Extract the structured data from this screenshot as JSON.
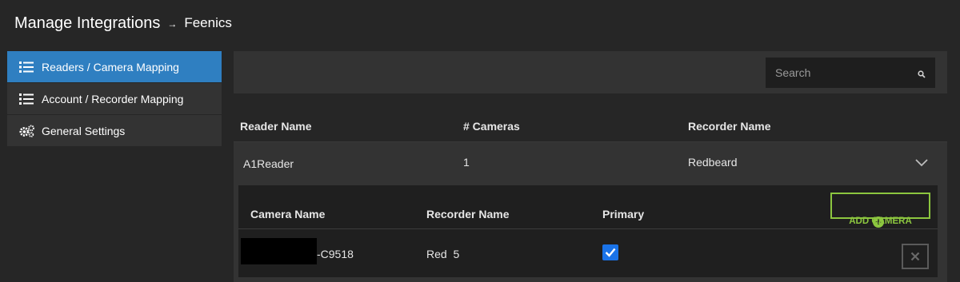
{
  "header": {
    "title": "Manage Integrations",
    "separator": "→",
    "crumb": "Feenics"
  },
  "sidebar": {
    "items": [
      {
        "label": "Readers / Camera Mapping",
        "icon": "list-icon",
        "active": true
      },
      {
        "label": "Account / Recorder Mapping",
        "icon": "list-icon",
        "active": false
      },
      {
        "label": "General Settings",
        "icon": "gears-icon",
        "active": false
      }
    ]
  },
  "search": {
    "placeholder": "Search",
    "value": ""
  },
  "table": {
    "columns": [
      "Reader Name",
      "# Cameras",
      "Recorder Name"
    ],
    "rows": [
      {
        "reader": "A1Reader",
        "cameras": "1",
        "recorder": "Redbeard"
      }
    ]
  },
  "subtable": {
    "columns": [
      "Camera Name",
      "Recorder Name",
      "Primary"
    ],
    "add_button": "ADD CAMERA",
    "rows": [
      {
        "camera_name": "-C9518",
        "recorder": "Red  5",
        "primary": true
      }
    ]
  },
  "colors": {
    "accent": "#2f7fc1",
    "add_green": "#8cc63f",
    "checkbox": "#1a73e8"
  }
}
